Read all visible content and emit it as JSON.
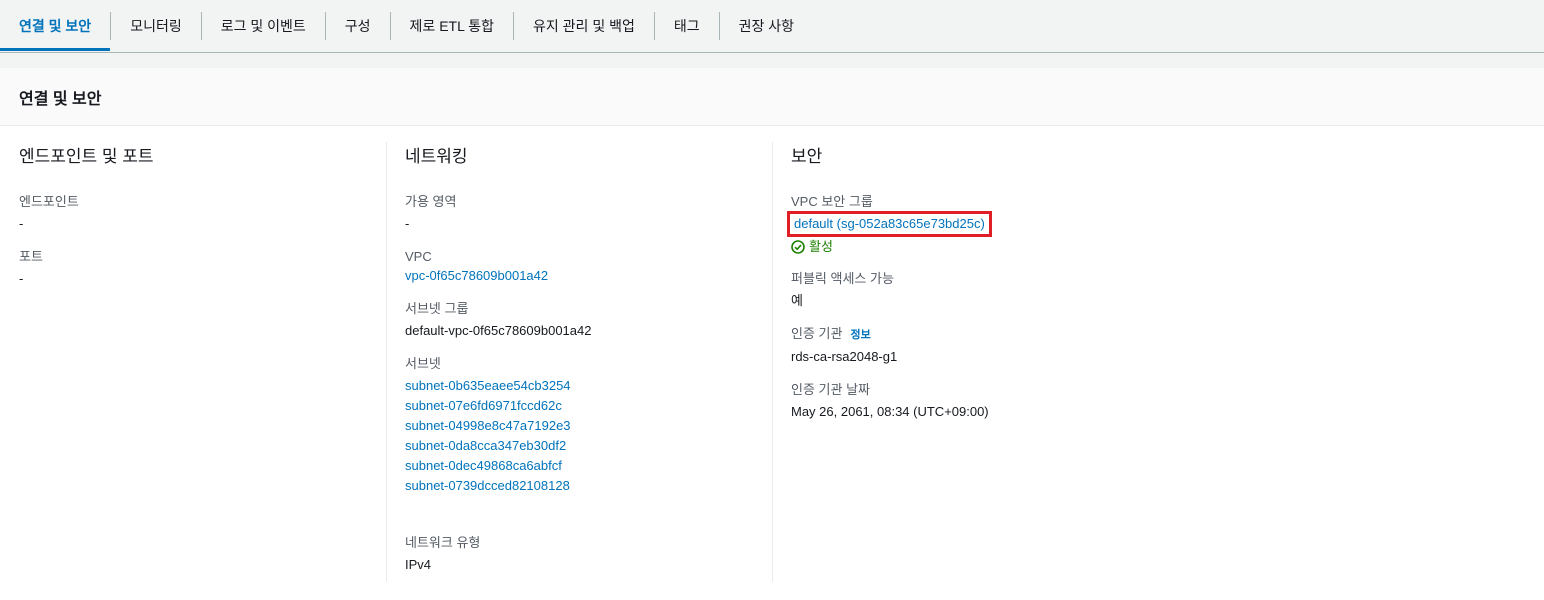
{
  "tabs": [
    {
      "label": "연결 및 보안",
      "active": true
    },
    {
      "label": "모니터링"
    },
    {
      "label": "로그 및 이벤트"
    },
    {
      "label": "구성"
    },
    {
      "label": "제로 ETL 통합"
    },
    {
      "label": "유지 관리 및 백업"
    },
    {
      "label": "태그"
    },
    {
      "label": "권장 사항"
    }
  ],
  "panel": {
    "title": "연결 및 보안"
  },
  "endpoints": {
    "title": "엔드포인트 및 포트",
    "endpoint_label": "엔드포인트",
    "endpoint_value": "-",
    "port_label": "포트",
    "port_value": "-"
  },
  "networking": {
    "title": "네트워킹",
    "az_label": "가용 영역",
    "az_value": "-",
    "vpc_label": "VPC",
    "vpc_value": "vpc-0f65c78609b001a42",
    "subnet_group_label": "서브넷 그룹",
    "subnet_group_value": "default-vpc-0f65c78609b001a42",
    "subnets_label": "서브넷",
    "subnets": [
      "subnet-0b635eaee54cb3254",
      "subnet-07e6fd6971fccd62c",
      "subnet-04998e8c47a7192e3",
      "subnet-0da8cca347eb30df2",
      "subnet-0dec49868ca6abfcf",
      "subnet-0739dcced82108128"
    ],
    "network_type_label": "네트워크 유형",
    "network_type_value": "IPv4"
  },
  "security": {
    "title": "보안",
    "vpc_sg_label": "VPC 보안 그룹",
    "vpc_sg_value": "default (sg-052a83c65e73bd25c)",
    "sg_status": "활성",
    "public_label": "퍼블릭 액세스 가능",
    "public_value": "예",
    "ca_label": "인증 기관",
    "ca_info": "정보",
    "ca_value": "rds-ca-rsa2048-g1",
    "ca_date_label": "인증 기관 날짜",
    "ca_date_value": "May 26, 2061, 08:34 (UTC+09:00)"
  },
  "colors": {
    "link": "#0073bb",
    "success": "#1d8102",
    "highlight": "#e01e25"
  }
}
